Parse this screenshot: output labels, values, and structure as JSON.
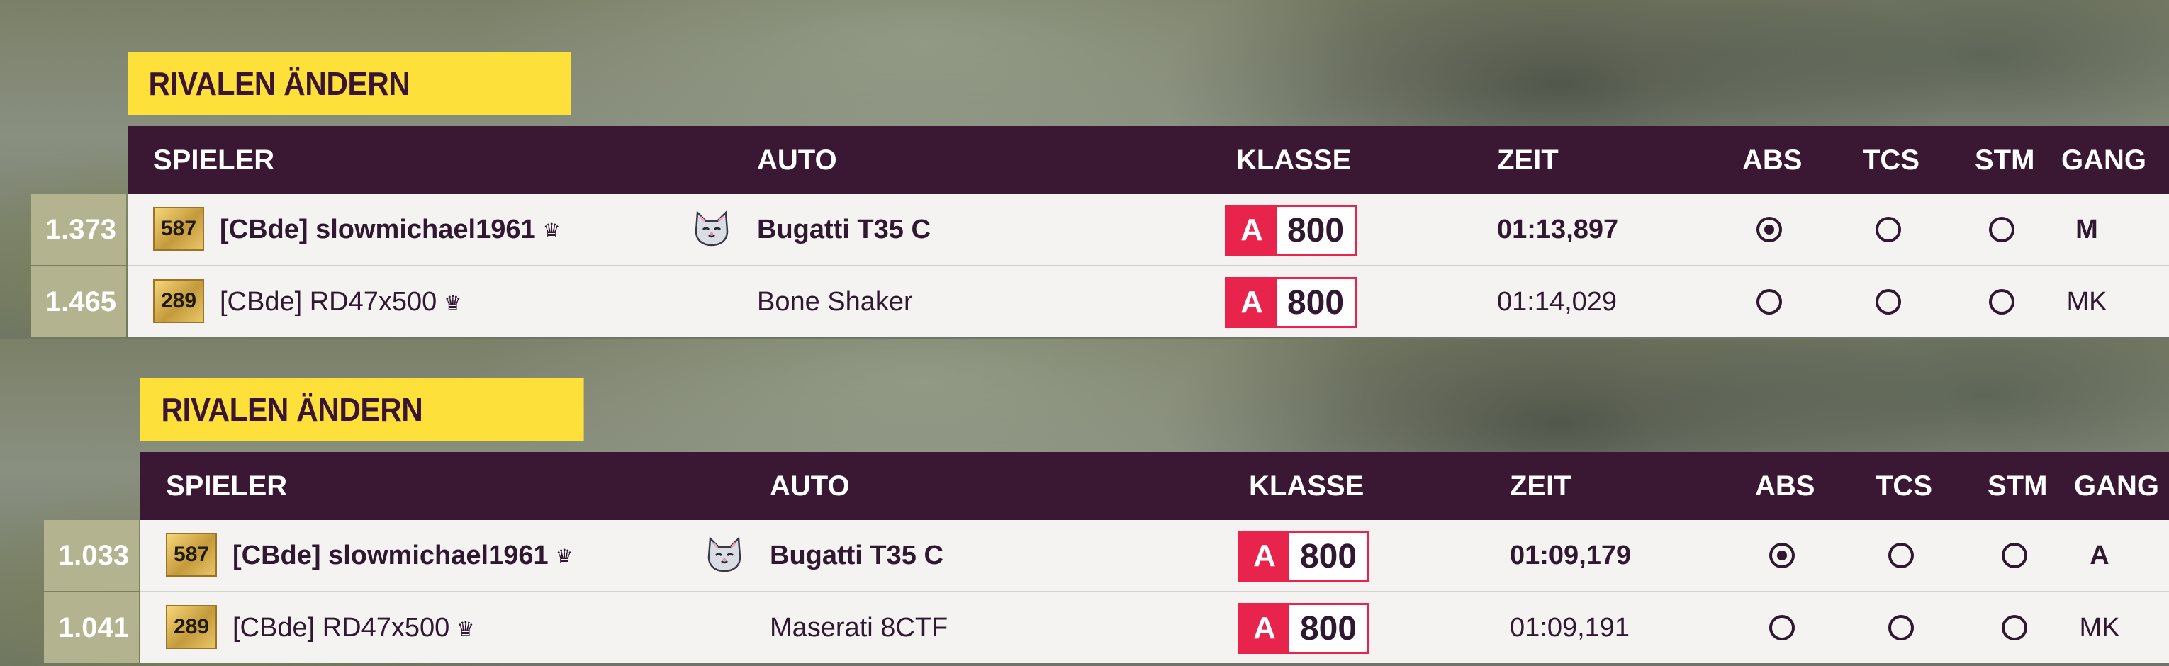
{
  "panels": [
    {
      "title": "RIVALEN ÄNDERN",
      "columns": {
        "player": "SPIELER",
        "car": "AUTO",
        "class": "KLASSE",
        "time": "ZEIT",
        "abs": "ABS",
        "tcs": "TCS",
        "stm": "STM",
        "gear": "GANG"
      },
      "rows": [
        {
          "rank": "1.373",
          "level": "587",
          "player": "[CBde] slowmichael1961",
          "crown": "♛",
          "has_cat_icon": true,
          "car": "Bugatti T35 C",
          "class_letter": "A",
          "class_value": "800",
          "time": "01:13,897",
          "abs": true,
          "tcs": false,
          "stm": false,
          "gear": "M",
          "highlight": true
        },
        {
          "rank": "1.465",
          "level": "289",
          "player": "[CBde] RD47x500",
          "crown": "♛",
          "has_cat_icon": false,
          "car": "Bone Shaker",
          "class_letter": "A",
          "class_value": "800",
          "time": "01:14,029",
          "abs": false,
          "tcs": false,
          "stm": false,
          "gear": "MK",
          "highlight": false
        }
      ]
    },
    {
      "title": "RIVALEN ÄNDERN",
      "columns": {
        "player": "SPIELER",
        "car": "AUTO",
        "class": "KLASSE",
        "time": "ZEIT",
        "abs": "ABS",
        "tcs": "TCS",
        "stm": "STM",
        "gear": "GANG"
      },
      "rows": [
        {
          "rank": "1.033",
          "level": "587",
          "player": "[CBde] slowmichael1961",
          "crown": "♛",
          "has_cat_icon": true,
          "car": "Bugatti T35 C",
          "class_letter": "A",
          "class_value": "800",
          "time": "01:09,179",
          "abs": true,
          "tcs": false,
          "stm": false,
          "gear": "A",
          "highlight": true
        },
        {
          "rank": "1.041",
          "level": "289",
          "player": "[CBde] RD47x500",
          "crown": "♛",
          "has_cat_icon": false,
          "car": "Maserati 8CTF",
          "class_letter": "A",
          "class_value": "800",
          "time": "01:09,191",
          "abs": false,
          "tcs": false,
          "stm": false,
          "gear": "MK",
          "highlight": false
        }
      ]
    }
  ],
  "colors": {
    "header_bg": "#3a1834",
    "banner_bg": "#fde03a",
    "class_red": "#e8244c",
    "row_bg": "#f4f3f2",
    "rank_bg": "#b3b48f"
  },
  "icons": {
    "crown": "crown-icon",
    "cat": "cat-face-icon",
    "radio": "radio-button"
  }
}
